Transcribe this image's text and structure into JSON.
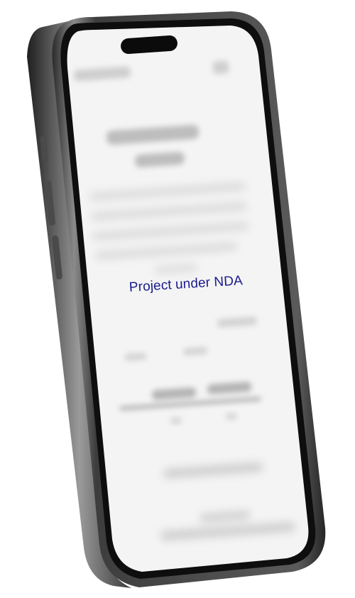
{
  "device": {
    "type": "smartphone",
    "frame_color": "#6b6b6b",
    "screen_color": "#f4f4f4"
  },
  "screen": {
    "overlay_text": "Project under NDA",
    "overlay_text_color": "#1a1a8c"
  }
}
